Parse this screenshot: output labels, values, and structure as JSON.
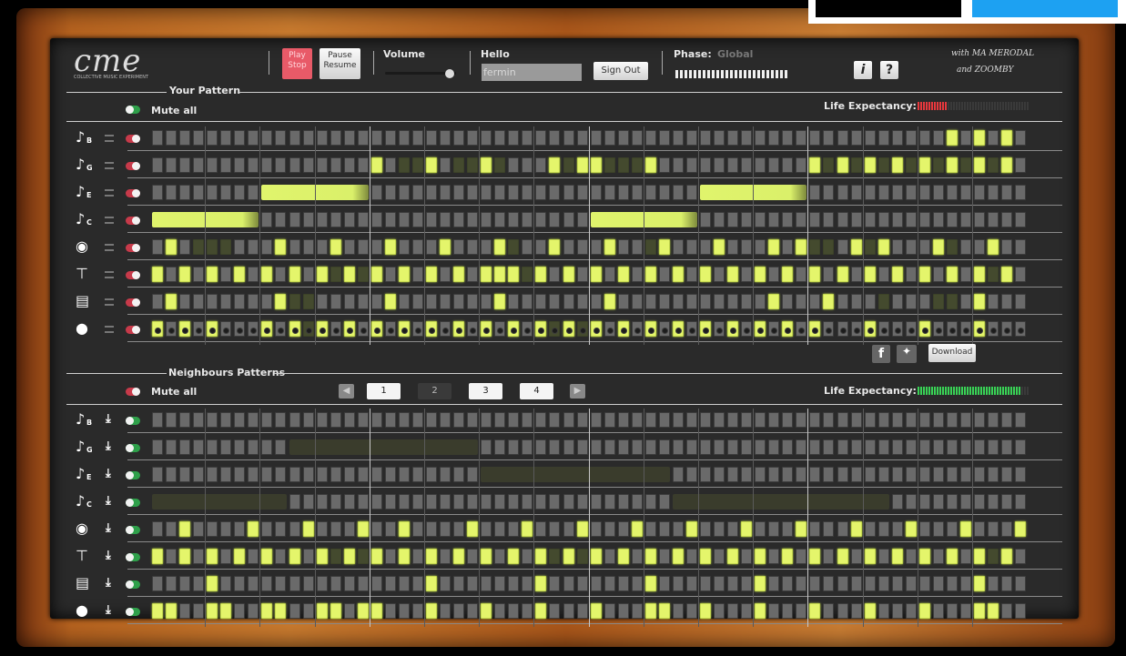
{
  "header": {
    "logo_text": "cme",
    "logo_subtitle": "COLLECTIVE MUSIC EXPERIMENT",
    "play_label_1": "Play",
    "play_label_2": "Stop",
    "pause_label_1": "Pause",
    "pause_label_2": "Resume",
    "volume_label": "Volume",
    "volume_level": 0.85,
    "hello_label": "Hello",
    "username_value": "fermin",
    "signout_label": "Sign Out",
    "phase_label": "Phase:",
    "phase_value": "Global",
    "info_label": "i",
    "help_label": "?",
    "credits_line1": "with MA MERODAL",
    "credits_line2": "and ZOOMBY"
  },
  "your_pattern": {
    "section_title": "Your Pattern",
    "mute_all_label": "Mute all",
    "life_label": "Life Expectancy:",
    "life_level": 0.28,
    "life_color": "#e8383d",
    "download_label": "Download",
    "facebook_label": "f",
    "instruments": [
      {
        "icon": "guitar-icon",
        "sub": "B",
        "muted": true
      },
      {
        "icon": "guitar-icon",
        "sub": "G",
        "muted": true
      },
      {
        "icon": "guitar-icon",
        "sub": "E",
        "muted": true
      },
      {
        "icon": "guitar-icon",
        "sub": "C",
        "muted": true
      },
      {
        "icon": "shaker-icon",
        "sub": "",
        "muted": true
      },
      {
        "icon": "cymbal-icon",
        "sub": "",
        "muted": true
      },
      {
        "icon": "keyboard-icon",
        "sub": "",
        "muted": true
      },
      {
        "icon": "drum-icon",
        "sub": "",
        "muted": true
      }
    ],
    "rows": [
      {
        "on": [
          58,
          60,
          62
        ],
        "dim": [],
        "bars": []
      },
      {
        "on": [
          16,
          20,
          24,
          29,
          31,
          32,
          36,
          48,
          50,
          52,
          54,
          56,
          58,
          60,
          62
        ],
        "dim": [
          18,
          19,
          22,
          23,
          25,
          30,
          33,
          34,
          35,
          49,
          51,
          53,
          55,
          57,
          59,
          61
        ],
        "bars": []
      },
      {
        "on": [],
        "dim": [],
        "bars": [
          [
            8,
            16
          ],
          [
            40,
            48
          ]
        ]
      },
      {
        "on": [],
        "dim": [],
        "bars": [
          [
            0,
            8
          ],
          [
            32,
            40
          ]
        ]
      },
      {
        "on": [
          1,
          9,
          13,
          17,
          21,
          25,
          29,
          33,
          37,
          41,
          45,
          47,
          51,
          53,
          57,
          61
        ],
        "dim": [
          3,
          4,
          5,
          26,
          36,
          48,
          49,
          52,
          58
        ],
        "bars": []
      },
      {
        "on": [
          0,
          2,
          4,
          6,
          8,
          10,
          12,
          14,
          16,
          18,
          20,
          22,
          24,
          25,
          26,
          28,
          30,
          32,
          34,
          36,
          38,
          40,
          42,
          44,
          46,
          48,
          50,
          52,
          54,
          56,
          58,
          60,
          62
        ],
        "dim": [
          13,
          15,
          27,
          61
        ],
        "bars": []
      },
      {
        "on": [
          1,
          9,
          17,
          25,
          33,
          45,
          49,
          60
        ],
        "dim": [
          10,
          11,
          53,
          57,
          58
        ],
        "bars": []
      },
      {
        "on": [
          0,
          2,
          4,
          8,
          10,
          12,
          14,
          16,
          18,
          20,
          22,
          24,
          26,
          28,
          30,
          32,
          34,
          36,
          38,
          40,
          42,
          44,
          46,
          48,
          52,
          56,
          60
        ],
        "dim": [
          11,
          29,
          31
        ],
        "bars": []
      }
    ]
  },
  "neighbours": {
    "section_title": "Neighbours Patterns",
    "mute_all_label": "Mute all",
    "life_label": "Life Expectancy:",
    "life_level": 0.92,
    "life_color": "#39d356",
    "pages": [
      "1",
      "2",
      "3",
      "4"
    ],
    "selected_page": "2",
    "instruments": [
      {
        "icon": "guitar-icon",
        "sub": "B"
      },
      {
        "icon": "guitar-icon",
        "sub": "G"
      },
      {
        "icon": "guitar-icon",
        "sub": "E"
      },
      {
        "icon": "guitar-icon",
        "sub": "C"
      },
      {
        "icon": "shaker-icon",
        "sub": ""
      },
      {
        "icon": "cymbal-icon",
        "sub": ""
      },
      {
        "icon": "keyboard-icon",
        "sub": ""
      },
      {
        "icon": "drum-icon",
        "sub": ""
      }
    ],
    "rows": [
      {
        "on": [],
        "dim": [],
        "bars": []
      },
      {
        "on": [],
        "dim": [],
        "bars": [
          [
            10,
            24
          ]
        ]
      },
      {
        "on": [],
        "dim": [],
        "bars": [
          [
            24,
            38
          ]
        ]
      },
      {
        "on": [],
        "dim": [],
        "bars": [
          [
            0,
            10
          ],
          [
            38,
            54
          ]
        ]
      },
      {
        "on": [
          2,
          7,
          11,
          15,
          18,
          23,
          27,
          31,
          35,
          39,
          43,
          47,
          51,
          55,
          59,
          63
        ],
        "dim": [],
        "bars": []
      },
      {
        "on": [
          0,
          2,
          4,
          6,
          8,
          10,
          12,
          14,
          16,
          18,
          20,
          22,
          24,
          26,
          28,
          30,
          32,
          34,
          36,
          38,
          40,
          42,
          44,
          46,
          48,
          50,
          52,
          54,
          56,
          58,
          60,
          62
        ],
        "dim": [
          13,
          15,
          29,
          31,
          61
        ],
        "bars": []
      },
      {
        "on": [
          4,
          20,
          28,
          36,
          44,
          60
        ],
        "dim": [],
        "bars": []
      },
      {
        "on": [
          0,
          1,
          4,
          5,
          8,
          9,
          12,
          13,
          15,
          16,
          20,
          24,
          28,
          32,
          36,
          37,
          40,
          44,
          48,
          52,
          56,
          60,
          61
        ],
        "dim": [],
        "bars": []
      }
    ]
  }
}
